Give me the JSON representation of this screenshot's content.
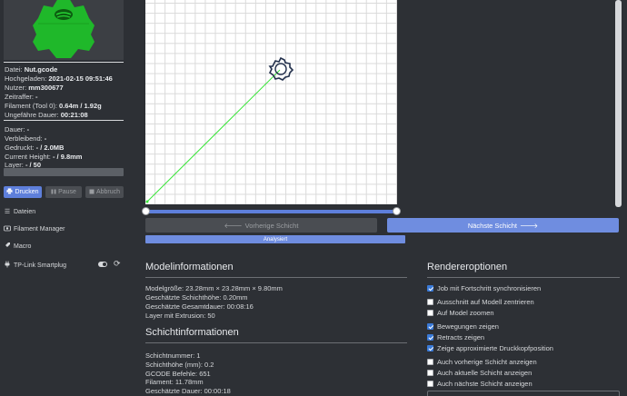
{
  "sidebar": {
    "file_info": [
      {
        "label": "Datei: ",
        "value": "Nut.gcode"
      },
      {
        "label": "Hochgeladen: ",
        "value": "2021-02-15 09:51:46"
      },
      {
        "label": "Nutzer: ",
        "value": "mm300677"
      },
      {
        "label": "Zeitraffer: ",
        "value": "-"
      },
      {
        "label": "Filament (Tool 0): ",
        "value": "0.64m / 1.92g"
      },
      {
        "label": "Ungefähre Dauer: ",
        "value": "00:21:08"
      }
    ],
    "job_info": [
      {
        "label": "Dauer: ",
        "value": "-"
      },
      {
        "label": "Verbleibend: ",
        "value": "-"
      },
      {
        "label": "Gedruckt: ",
        "value": "- / 2.0MB"
      },
      {
        "label": "Current Height: ",
        "value": "- / 9.8mm"
      },
      {
        "label": "Layer: ",
        "value": "- / 50"
      }
    ],
    "progress": 0,
    "buttons": {
      "print": "Drucken",
      "pause": "Pause",
      "cancel": "Abbruch"
    },
    "nav": {
      "files": "Dateien",
      "filament": "Filament Manager",
      "macro": "Macro",
      "smartplug": "TP-Link Smartplug"
    }
  },
  "viewer": {
    "prev_label": "Vorherige Schicht",
    "next_label": "Nächste Schicht",
    "analysed_label": "Analysiert"
  },
  "model_info": {
    "title": "Modelinformationen",
    "lines": [
      "Modelgröße: 23.28mm × 23.28mm × 9.80mm",
      "Geschätzte Schichthöhe: 0.20mm",
      "Geschätzte Gesamtdauer: 00:08:16",
      "Layer mit Extrusion: 50"
    ]
  },
  "layer_info": {
    "title": "Schichtinformationen",
    "lines": [
      "Schichtnummer: 1",
      "Schichthöhe (mm): 0.2",
      "GCODE Befehle: 651",
      "Filament: 11.78mm",
      "Geschätzte Dauer: 00:00:18"
    ]
  },
  "render_options": {
    "title": "Rendereroptionen",
    "options": [
      {
        "label": "Job mit Fortschritt synchronisieren",
        "checked": true
      },
      {
        "label": "Ausschnitt auf Modell zentrieren",
        "checked": false
      },
      {
        "label": "Auf Model zoomen",
        "checked": false
      },
      {
        "label": "Bewegungen zeigen",
        "checked": true
      },
      {
        "label": "Retracts zeigen",
        "checked": true
      },
      {
        "label": "Zeige approximierte Druckkopfposition",
        "checked": true
      },
      {
        "label": "Auch vorherige Schicht anzeigen",
        "checked": false
      },
      {
        "label": "Auch aktuelle Schicht anzeigen",
        "checked": false
      },
      {
        "label": "Auch nächste Schicht anzeigen",
        "checked": false
      }
    ]
  },
  "colors": {
    "accent": "#5e7fdb",
    "nut": "#22c02a",
    "travel": "#39e639"
  }
}
